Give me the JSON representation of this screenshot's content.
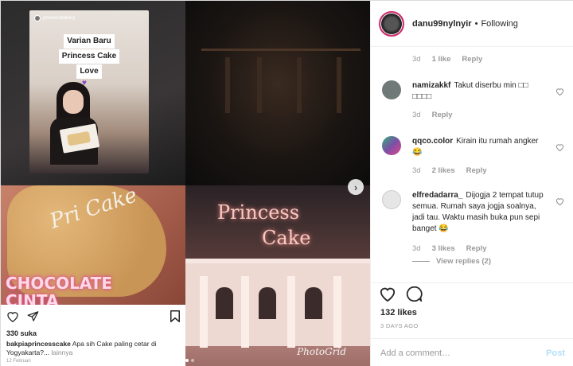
{
  "media": {
    "story_user": "princessbakery",
    "story_caption_lines": [
      "Varian Baru",
      "Princess Cake",
      "Love"
    ],
    "cake_script": "Pri Cake",
    "chocolate_lines": [
      "CHOCOLATE",
      "CINTA"
    ],
    "neon_top": "Princess",
    "neon_bottom": "Cake",
    "watermark": "PhotoGrid",
    "next_arrow": "›"
  },
  "embedded_post": {
    "likes": "330 suka",
    "username": "bakpiaprincesscake",
    "caption": "Apa sih Cake paling cetar di Yogyakarta?...",
    "more": "lainnya",
    "date": "12 Februari"
  },
  "header": {
    "username": "danu99nylnyir",
    "separator": "•",
    "follow_status": "Following"
  },
  "top_meta": {
    "time": "3d",
    "likes": "1 like",
    "reply": "Reply"
  },
  "comments": [
    {
      "username": "namizakkf",
      "text": "Takut diserbu min □□ □□□□",
      "time": "3d",
      "likes": "",
      "reply": "Reply",
      "avatar_color": "#6f7a78"
    },
    {
      "username": "qqco.color",
      "text": "Kirain itu rumah angker 😂",
      "time": "3d",
      "likes": "2 likes",
      "reply": "Reply",
      "avatar_color": "#7a4fa6"
    },
    {
      "username": "elfredadarra_",
      "text": "Dijogja 2 tempat tutup semua. Rumah saya jogja soalnya, jadi tau. Waktu masih buka pun sepi banget 😂",
      "time": "3d",
      "likes": "3 likes",
      "reply": "Reply",
      "avatar_color": "#e6e6e6"
    }
  ],
  "view_replies": "View replies (2)",
  "post": {
    "likes": "132 likes",
    "time_ago": "3 DAYS AGO"
  },
  "add_comment": {
    "placeholder": "Add a comment…",
    "post_label": "Post"
  },
  "colors": {
    "accent_disabled": "#b2dffc",
    "meta_gray": "#999999",
    "story_ring": "#d22b6d"
  }
}
